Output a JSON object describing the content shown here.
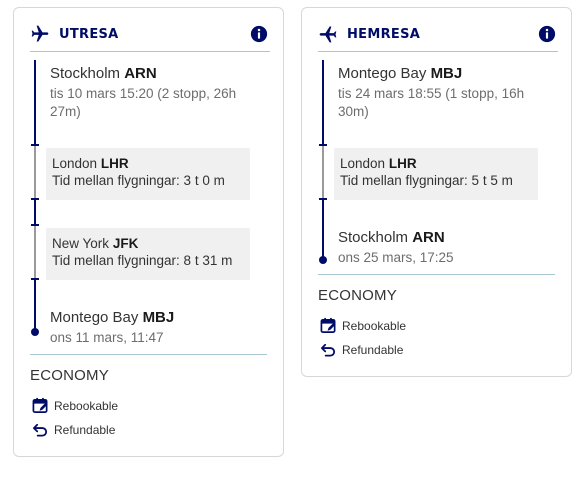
{
  "colors": {
    "brand": "#000c66",
    "separator": "#a9c6d3",
    "layover_bg": "#f0f0f0"
  },
  "outbound": {
    "title": "UTRESA",
    "icons": {
      "header": "plane-icon",
      "info": "info-icon"
    },
    "departure": {
      "city": "Stockholm",
      "code": "ARN",
      "meta": "tis 10 mars 15:20 (2 stopp, 26h 27m)"
    },
    "layovers": [
      {
        "city": "London",
        "code": "LHR",
        "time": "Tid mellan flygningar: 3 t 0 m"
      },
      {
        "city": "New York",
        "code": "JFK",
        "time": "Tid mellan flygningar: 8 t 31 m"
      }
    ],
    "arrival": {
      "city": "Montego Bay",
      "code": "MBJ",
      "meta": "ons 11 mars, 11:47"
    },
    "cabin": "ECONOMY",
    "features": [
      {
        "icon": "calendar-edit-icon",
        "label": "Rebookable"
      },
      {
        "icon": "undo-arrow-icon",
        "label": "Refundable"
      }
    ]
  },
  "inbound": {
    "title": "HEMRESA",
    "icons": {
      "header": "plane-icon",
      "info": "info-icon"
    },
    "departure": {
      "city": "Montego Bay",
      "code": "MBJ",
      "meta": "tis 24 mars 18:55 (1 stopp, 16h 30m)"
    },
    "layovers": [
      {
        "city": "London",
        "code": "LHR",
        "time": "Tid mellan flygningar: 5 t 5 m"
      }
    ],
    "arrival": {
      "city": "Stockholm",
      "code": "ARN",
      "meta": "ons 25 mars, 17:25"
    },
    "cabin": "ECONOMY",
    "features": [
      {
        "icon": "calendar-edit-icon",
        "label": "Rebookable"
      },
      {
        "icon": "undo-arrow-icon",
        "label": "Refundable"
      }
    ]
  }
}
